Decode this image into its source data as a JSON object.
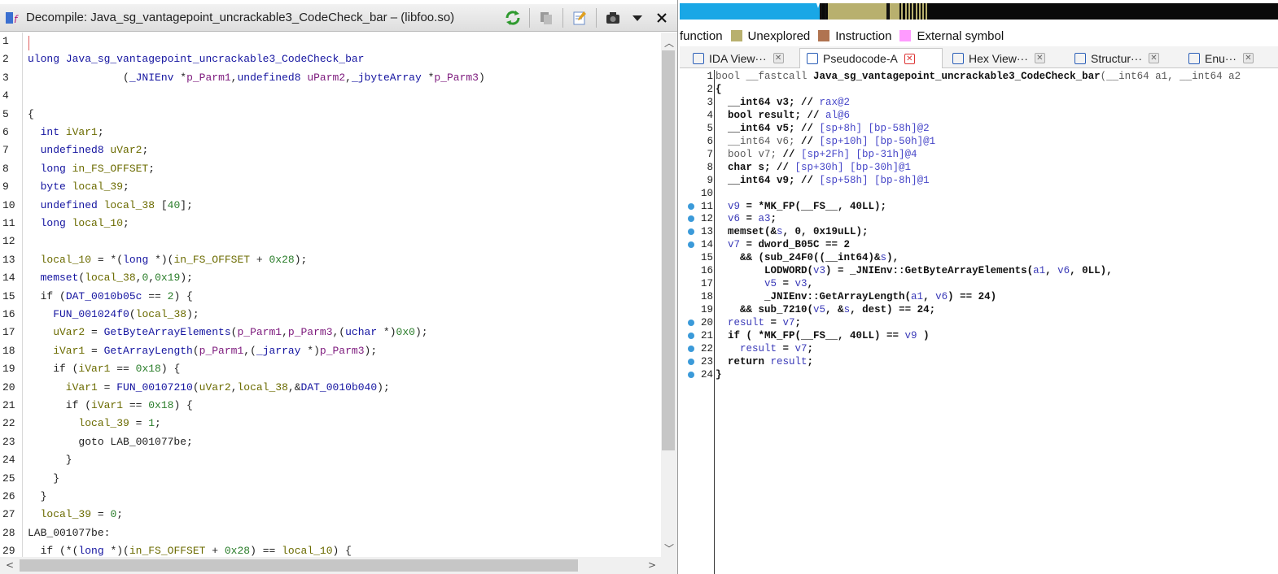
{
  "left": {
    "title": "Decompile: Java_sg_vantagepoint_uncrackable3_CodeCheck_bar –  (libfoo.so)",
    "toolbar_icons": [
      "refresh-icon",
      "copy-icon",
      "edit-icon",
      "snapshot-icon",
      "menu-icon",
      "close-icon"
    ],
    "lines": [
      {
        "n": "1",
        "segs": []
      },
      {
        "n": "2",
        "segs": [
          [
            "t",
            "ulong "
          ],
          [
            "f",
            "Java_sg_vantagepoint_uncrackable3_CodeCheck_bar"
          ]
        ]
      },
      {
        "n": "3",
        "segs": [
          [
            "g",
            "               ("
          ],
          [
            "t",
            "_JNIEnv "
          ],
          [
            "g",
            "*"
          ],
          [
            "p",
            "p_Parm1"
          ],
          [
            "g",
            ","
          ],
          [
            "t",
            "undefined8 "
          ],
          [
            "p",
            "uParm2"
          ],
          [
            "g",
            ","
          ],
          [
            "t",
            "_jbyteArray "
          ],
          [
            "g",
            "*"
          ],
          [
            "p",
            "p_Parm3"
          ],
          [
            "g",
            ")"
          ]
        ]
      },
      {
        "n": "4",
        "segs": []
      },
      {
        "n": "5",
        "segs": [
          [
            "g",
            "{"
          ]
        ]
      },
      {
        "n": "6",
        "segs": [
          [
            "t",
            "  int "
          ],
          [
            "v",
            "iVar1"
          ],
          [
            "g",
            ";"
          ]
        ]
      },
      {
        "n": "7",
        "segs": [
          [
            "t",
            "  undefined8 "
          ],
          [
            "v",
            "uVar2"
          ],
          [
            "g",
            ";"
          ]
        ]
      },
      {
        "n": "8",
        "segs": [
          [
            "t",
            "  long "
          ],
          [
            "v",
            "in_FS_OFFSET"
          ],
          [
            "g",
            ";"
          ]
        ]
      },
      {
        "n": "9",
        "segs": [
          [
            "t",
            "  byte "
          ],
          [
            "v",
            "local_39"
          ],
          [
            "g",
            ";"
          ]
        ]
      },
      {
        "n": "10",
        "segs": [
          [
            "t",
            "  undefined "
          ],
          [
            "v",
            "local_38 "
          ],
          [
            "g",
            "["
          ],
          [
            "n",
            "40"
          ],
          [
            "g",
            "];"
          ]
        ]
      },
      {
        "n": "11",
        "segs": [
          [
            "t",
            "  long "
          ],
          [
            "v",
            "local_10"
          ],
          [
            "g",
            ";"
          ]
        ]
      },
      {
        "n": "12",
        "segs": []
      },
      {
        "n": "13",
        "segs": [
          [
            "v",
            "  local_10 "
          ],
          [
            "g",
            "= *("
          ],
          [
            "t",
            "long "
          ],
          [
            "g",
            "*)("
          ],
          [
            "v",
            "in_FS_OFFSET "
          ],
          [
            "g",
            "+ "
          ],
          [
            "n",
            "0x28"
          ],
          [
            "g",
            ");"
          ]
        ]
      },
      {
        "n": "14",
        "segs": [
          [
            "f",
            "  memset"
          ],
          [
            "g",
            "("
          ],
          [
            "v",
            "local_38"
          ],
          [
            "g",
            ","
          ],
          [
            "n",
            "0"
          ],
          [
            "g",
            ","
          ],
          [
            "n",
            "0x19"
          ],
          [
            "g",
            ");"
          ]
        ]
      },
      {
        "n": "15",
        "segs": [
          [
            "g",
            "  if ("
          ],
          [
            "d",
            "DAT_0010b05c "
          ],
          [
            "g",
            "== "
          ],
          [
            "n",
            "2"
          ],
          [
            "g",
            ") {"
          ]
        ]
      },
      {
        "n": "16",
        "segs": [
          [
            "f",
            "    FUN_001024f0"
          ],
          [
            "g",
            "("
          ],
          [
            "v",
            "local_38"
          ],
          [
            "g",
            ");"
          ]
        ]
      },
      {
        "n": "17",
        "segs": [
          [
            "v",
            "    uVar2 "
          ],
          [
            "g",
            "= "
          ],
          [
            "f",
            "GetByteArrayElements"
          ],
          [
            "g",
            "("
          ],
          [
            "p",
            "p_Parm1"
          ],
          [
            "g",
            ","
          ],
          [
            "p",
            "p_Parm3"
          ],
          [
            "g",
            ",("
          ],
          [
            "t",
            "uchar "
          ],
          [
            "g",
            "*)"
          ],
          [
            "n",
            "0x0"
          ],
          [
            "g",
            ");"
          ]
        ]
      },
      {
        "n": "18",
        "segs": [
          [
            "v",
            "    iVar1 "
          ],
          [
            "g",
            "= "
          ],
          [
            "f",
            "GetArrayLength"
          ],
          [
            "g",
            "("
          ],
          [
            "p",
            "p_Parm1"
          ],
          [
            "g",
            ",("
          ],
          [
            "t",
            "_jarray "
          ],
          [
            "g",
            "*)"
          ],
          [
            "p",
            "p_Parm3"
          ],
          [
            "g",
            ");"
          ]
        ]
      },
      {
        "n": "19",
        "segs": [
          [
            "g",
            "    if ("
          ],
          [
            "v",
            "iVar1 "
          ],
          [
            "g",
            "== "
          ],
          [
            "n",
            "0x18"
          ],
          [
            "g",
            ") {"
          ]
        ]
      },
      {
        "n": "20",
        "segs": [
          [
            "v",
            "      iVar1 "
          ],
          [
            "g",
            "= "
          ],
          [
            "f",
            "FUN_00107210"
          ],
          [
            "g",
            "("
          ],
          [
            "v",
            "uVar2"
          ],
          [
            "g",
            ","
          ],
          [
            "v",
            "local_38"
          ],
          [
            "g",
            ",&"
          ],
          [
            "d",
            "DAT_0010b040"
          ],
          [
            "g",
            ");"
          ]
        ]
      },
      {
        "n": "21",
        "segs": [
          [
            "g",
            "      if ("
          ],
          [
            "v",
            "iVar1 "
          ],
          [
            "g",
            "== "
          ],
          [
            "n",
            "0x18"
          ],
          [
            "g",
            ") {"
          ]
        ]
      },
      {
        "n": "22",
        "segs": [
          [
            "v",
            "        local_39 "
          ],
          [
            "g",
            "= "
          ],
          [
            "n",
            "1"
          ],
          [
            "g",
            ";"
          ]
        ]
      },
      {
        "n": "23",
        "segs": [
          [
            "g",
            "        goto LAB_001077be;"
          ]
        ]
      },
      {
        "n": "24",
        "segs": [
          [
            "g",
            "      }"
          ]
        ]
      },
      {
        "n": "25",
        "segs": [
          [
            "g",
            "    }"
          ]
        ]
      },
      {
        "n": "26",
        "segs": [
          [
            "g",
            "  }"
          ]
        ]
      },
      {
        "n": "27",
        "segs": [
          [
            "v",
            "  local_39 "
          ],
          [
            "g",
            "= "
          ],
          [
            "n",
            "0"
          ],
          [
            "g",
            ";"
          ]
        ]
      },
      {
        "n": "28",
        "segs": [
          [
            "g",
            "LAB_001077be:"
          ]
        ]
      },
      {
        "n": "29",
        "segs": [
          [
            "g",
            "  if (*("
          ],
          [
            "t",
            "long "
          ],
          [
            "g",
            "*)("
          ],
          [
            "v",
            "in_FS_OFFSET "
          ],
          [
            "g",
            "+ "
          ],
          [
            "n",
            "0x28"
          ],
          [
            "g",
            ") == "
          ],
          [
            "v",
            "local_10"
          ],
          [
            "g",
            ") {"
          ]
        ]
      }
    ]
  },
  "right": {
    "legend": [
      {
        "label": "function",
        "color": ""
      },
      {
        "label": "Unexplored",
        "color": "#b8b06e"
      },
      {
        "label": "Instruction",
        "color": "#b07350"
      },
      {
        "label": "External symbol",
        "color": "#ff9bff"
      }
    ],
    "tabs": [
      {
        "label": "IDA View···",
        "active": false
      },
      {
        "label": "Pseudocode-A",
        "active": true
      },
      {
        "label": "Hex View···",
        "active": false
      },
      {
        "label": "Structur···",
        "active": false
      },
      {
        "label": "Enu···",
        "active": false
      }
    ],
    "lines": [
      {
        "n": "1",
        "bp": false,
        "segs": [
          [
            "kn",
            "bool __fastcall "
          ],
          [
            "k",
            "Java_sg_vantagepoint_uncrackable3_CodeCheck_bar"
          ],
          [
            "kn",
            "(__int64 a1, __int64 a2"
          ]
        ]
      },
      {
        "n": "2",
        "bp": false,
        "segs": [
          [
            "k",
            "{"
          ]
        ]
      },
      {
        "n": "3",
        "bp": false,
        "segs": [
          [
            "k",
            "  __int64 v3; "
          ],
          [
            "k",
            "// "
          ],
          [
            "c",
            "rax@2"
          ]
        ]
      },
      {
        "n": "4",
        "bp": false,
        "segs": [
          [
            "k",
            "  bool result; "
          ],
          [
            "k",
            "// "
          ],
          [
            "c",
            "al@6"
          ]
        ]
      },
      {
        "n": "5",
        "bp": false,
        "segs": [
          [
            "k",
            "  __int64 v5; "
          ],
          [
            "k",
            "// "
          ],
          [
            "c",
            "[sp+8h] [bp-58h]@2"
          ]
        ]
      },
      {
        "n": "6",
        "bp": false,
        "segs": [
          [
            "kn",
            "  __int64 v6; "
          ],
          [
            "k",
            "// "
          ],
          [
            "c",
            "[sp+10h] [bp-50h]@1"
          ]
        ]
      },
      {
        "n": "7",
        "bp": false,
        "segs": [
          [
            "kn",
            "  bool v7; "
          ],
          [
            "k",
            "// "
          ],
          [
            "c",
            "[sp+2Fh] [bp-31h]@4"
          ]
        ]
      },
      {
        "n": "8",
        "bp": false,
        "segs": [
          [
            "k",
            "  char s; "
          ],
          [
            "k",
            "// "
          ],
          [
            "c",
            "[sp+30h] [bp-30h]@1"
          ]
        ]
      },
      {
        "n": "9",
        "bp": false,
        "segs": [
          [
            "k",
            "  __int64 v9; "
          ],
          [
            "k",
            "// "
          ],
          [
            "c",
            "[sp+58h] [bp-8h]@1"
          ]
        ]
      },
      {
        "n": "10",
        "bp": false,
        "segs": []
      },
      {
        "n": "11",
        "bp": true,
        "segs": [
          [
            "vn",
            "  v9 "
          ],
          [
            "k",
            "= *MK_FP(__FS__, 40LL);"
          ]
        ]
      },
      {
        "n": "12",
        "bp": true,
        "segs": [
          [
            "vn",
            "  v6 "
          ],
          [
            "k",
            "= "
          ],
          [
            "vn",
            "a3"
          ],
          [
            "k",
            ";"
          ]
        ]
      },
      {
        "n": "13",
        "bp": true,
        "segs": [
          [
            "k",
            "  memset(&"
          ],
          [
            "vn",
            "s"
          ],
          [
            "k",
            ", 0, 0x19uLL);"
          ]
        ]
      },
      {
        "n": "14",
        "bp": true,
        "segs": [
          [
            "vn",
            "  v7 "
          ],
          [
            "k",
            "= dword_B05C == 2"
          ]
        ]
      },
      {
        "n": "15",
        "bp": false,
        "segs": [
          [
            "k",
            "    && (sub_24F0((__int64)&"
          ],
          [
            "vn",
            "s"
          ],
          [
            "k",
            "),"
          ]
        ]
      },
      {
        "n": "16",
        "bp": false,
        "segs": [
          [
            "k",
            "        LODWORD("
          ],
          [
            "vn",
            "v3"
          ],
          [
            "k",
            ") = _JNIEnv::GetByteArrayElements("
          ],
          [
            "vn",
            "a1"
          ],
          [
            "k",
            ", "
          ],
          [
            "vn",
            "v6"
          ],
          [
            "k",
            ", 0LL),"
          ]
        ]
      },
      {
        "n": "17",
        "bp": false,
        "segs": [
          [
            "vn",
            "        v5 "
          ],
          [
            "k",
            "= "
          ],
          [
            "vn",
            "v3"
          ],
          [
            "k",
            ","
          ]
        ]
      },
      {
        "n": "18",
        "bp": false,
        "segs": [
          [
            "k",
            "        _JNIEnv::GetArrayLength("
          ],
          [
            "vn",
            "a1"
          ],
          [
            "k",
            ", "
          ],
          [
            "vn",
            "v6"
          ],
          [
            "k",
            ") == 24)"
          ]
        ]
      },
      {
        "n": "19",
        "bp": false,
        "segs": [
          [
            "k",
            "    && sub_7210("
          ],
          [
            "vn",
            "v5"
          ],
          [
            "k",
            ", &"
          ],
          [
            "vn",
            "s"
          ],
          [
            "k",
            ", dest) == 24;"
          ]
        ]
      },
      {
        "n": "20",
        "bp": true,
        "segs": [
          [
            "vn",
            "  result "
          ],
          [
            "k",
            "= "
          ],
          [
            "vn",
            "v7"
          ],
          [
            "k",
            ";"
          ]
        ]
      },
      {
        "n": "21",
        "bp": true,
        "segs": [
          [
            "k",
            "  if ( *MK_FP(__FS__, 40LL) == "
          ],
          [
            "vn",
            "v9"
          ],
          [
            "k",
            " )"
          ]
        ]
      },
      {
        "n": "22",
        "bp": true,
        "segs": [
          [
            "vn",
            "    result "
          ],
          [
            "k",
            "= "
          ],
          [
            "vn",
            "v7"
          ],
          [
            "k",
            ";"
          ]
        ]
      },
      {
        "n": "23",
        "bp": true,
        "segs": [
          [
            "k",
            "  return "
          ],
          [
            "vn",
            "result"
          ],
          [
            "k",
            ";"
          ]
        ]
      },
      {
        "n": "24",
        "bp": true,
        "segs": [
          [
            "k",
            "}"
          ]
        ]
      }
    ]
  }
}
